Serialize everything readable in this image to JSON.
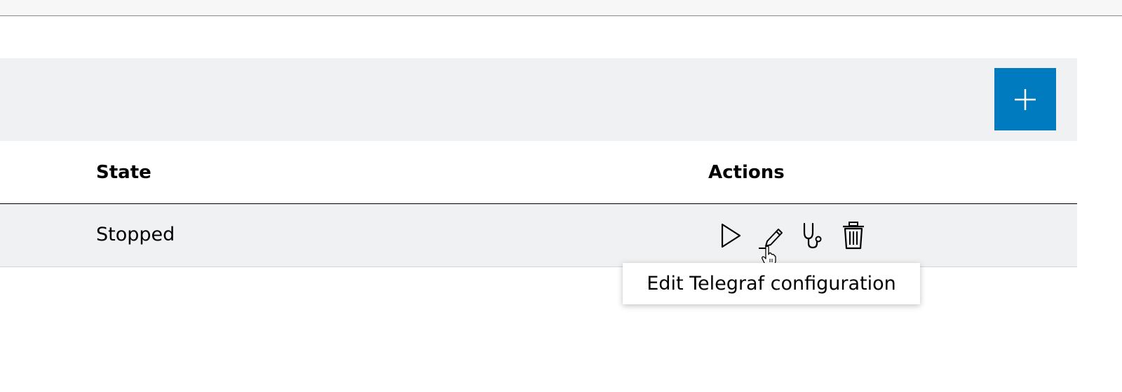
{
  "toolbar": {
    "add_label": "+"
  },
  "table": {
    "columns": [
      "State",
      "Actions"
    ],
    "rows": [
      {
        "state": "Stopped"
      }
    ]
  },
  "actions": [
    "start-icon",
    "edit-icon",
    "stethoscope-icon",
    "trash-icon"
  ],
  "tooltip": {
    "text": "Edit Telegraf configuration"
  },
  "colors": {
    "accent": "#007bc0",
    "row_bg": "#eff1f2"
  }
}
